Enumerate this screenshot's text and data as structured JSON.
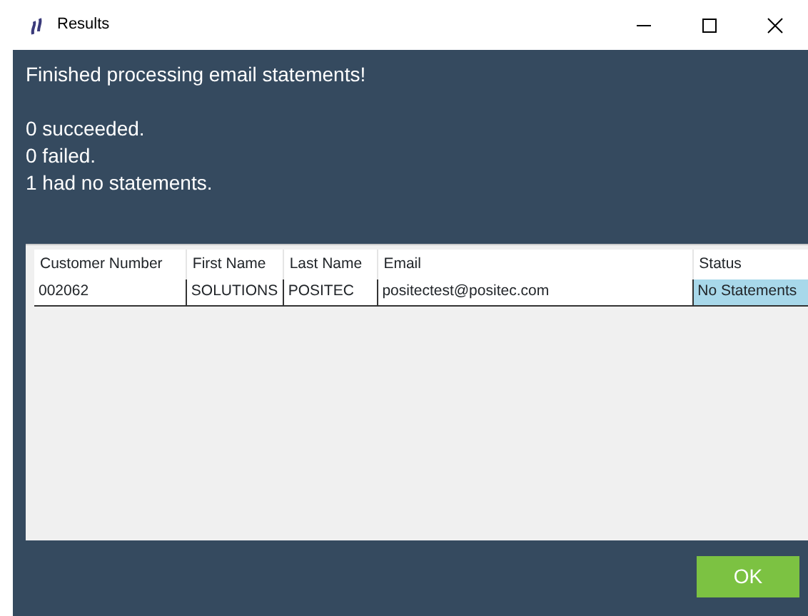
{
  "window": {
    "title": "Results"
  },
  "heading": "Finished processing email statements!",
  "messages": [
    "0 succeeded.",
    "0 failed.",
    "1 had no statements."
  ],
  "table": {
    "columns": [
      "Customer Number",
      "First Name",
      "Last Name",
      "Email",
      "Status"
    ],
    "rows": [
      {
        "cells": [
          {
            "text": "002062",
            "selected": false
          },
          {
            "text": "SOLUTIONS",
            "selected": false
          },
          {
            "text": "POSITEC",
            "selected": false
          },
          {
            "text": "positectest@positec.com",
            "selected": false
          },
          {
            "text": "No Statements",
            "selected": true
          }
        ]
      }
    ]
  },
  "buttons": [
    "OK"
  ]
}
